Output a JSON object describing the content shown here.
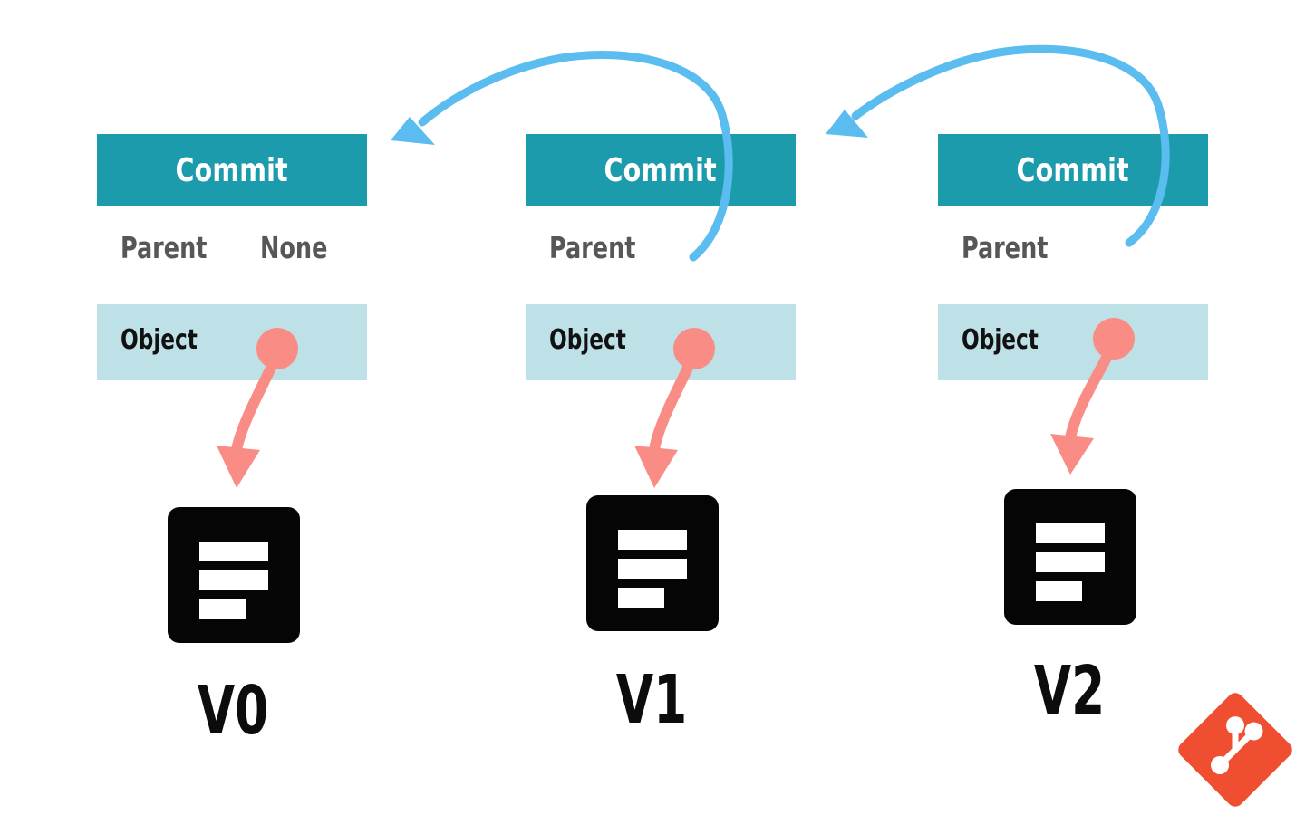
{
  "diagram": {
    "title": "Git commit chain",
    "background_color": "#ffffff",
    "colors": {
      "commit_header": "#1C9BAC",
      "object_bar": "#BEE0E7",
      "parent_text": "#575757",
      "object_text": "#111111",
      "file_icon": "#050505",
      "parent_arrow": "#5BBCF0",
      "object_arrow": "#F98D85",
      "git_logo": "#F04E30",
      "version_text": "#0c0c0c"
    },
    "commits": [
      {
        "header_label": "Commit",
        "parent_label": "Parent",
        "parent_value": "None",
        "object_label": "Object",
        "version_label": "V0",
        "file_icon": "document-icon"
      },
      {
        "header_label": "Commit",
        "parent_label": "Parent",
        "parent_value": "",
        "object_label": "Object",
        "version_label": "V1",
        "file_icon": "document-icon"
      },
      {
        "header_label": "Commit",
        "parent_label": "Parent",
        "parent_value": "",
        "object_label": "Object",
        "version_label": "V2",
        "file_icon": "document-icon"
      }
    ],
    "parent_arrows": [
      {
        "from": "V1",
        "to": "V0",
        "color": "#5BBCF0"
      },
      {
        "from": "V2",
        "to": "V1",
        "color": "#5BBCF0"
      }
    ],
    "object_arrows": [
      {
        "from": "V0 object",
        "to": "V0 file",
        "color": "#F98D85"
      },
      {
        "from": "V1 object",
        "to": "V1 file",
        "color": "#F98D85"
      },
      {
        "from": "V2 object",
        "to": "V2 file",
        "color": "#F98D85"
      }
    ],
    "logo": {
      "name": "git-logo",
      "color": "#F04E30"
    }
  }
}
